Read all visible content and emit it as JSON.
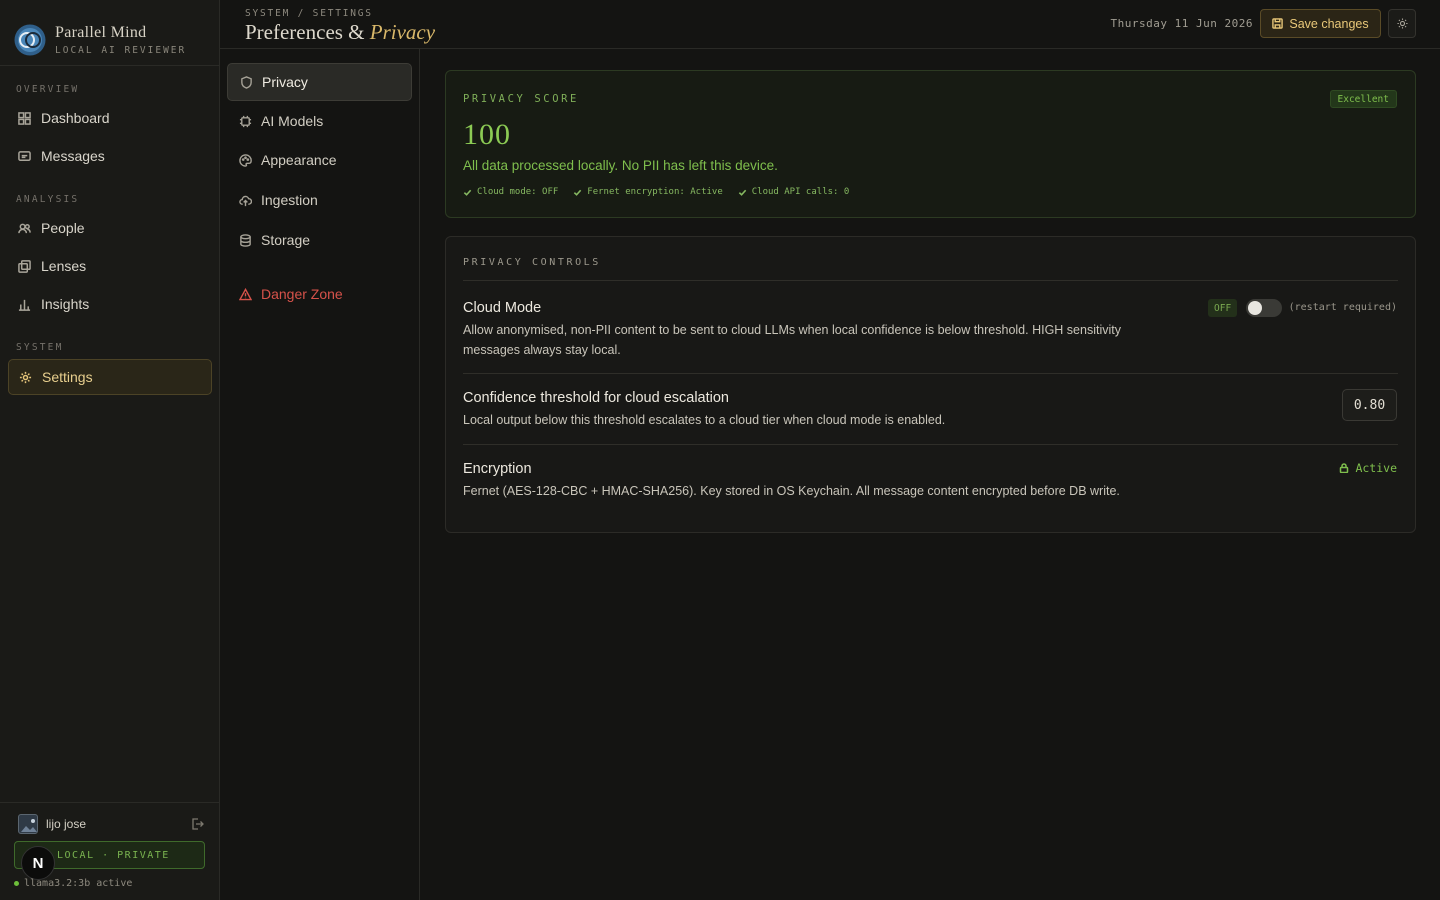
{
  "brand": {
    "name": "Parallel Mind",
    "tagline": "LOCAL AI REVIEWER"
  },
  "sidebar": {
    "sections": [
      {
        "label": "OVERVIEW",
        "items": [
          {
            "label": "Dashboard",
            "icon": "grid-icon"
          },
          {
            "label": "Messages",
            "icon": "message-icon"
          }
        ]
      },
      {
        "label": "ANALYSIS",
        "items": [
          {
            "label": "People",
            "icon": "people-icon"
          },
          {
            "label": "Lenses",
            "icon": "lenses-icon"
          },
          {
            "label": "Insights",
            "icon": "bar-chart-icon"
          }
        ]
      },
      {
        "label": "SYSTEM",
        "items": [
          {
            "label": "Settings",
            "icon": "gear-icon",
            "active": true
          }
        ]
      }
    ],
    "user": {
      "name": "lijo jose"
    },
    "local_badge": "LOCAL · PRIVATE",
    "avatar_initial": "N",
    "model_status": "llama3.2:3b active"
  },
  "header": {
    "breadcrumb": "SYSTEM / SETTINGS",
    "title_main": "Preferences & ",
    "title_accent": "Privacy",
    "date": "Thursday 11 Jun 2026",
    "save_label": "Save changes"
  },
  "subnav": {
    "items": [
      {
        "label": "Privacy",
        "icon": "shield-icon",
        "active": true
      },
      {
        "label": "AI Models",
        "icon": "chip-icon"
      },
      {
        "label": "Appearance",
        "icon": "palette-icon"
      },
      {
        "label": "Ingestion",
        "icon": "cloud-upload-icon"
      },
      {
        "label": "Storage",
        "icon": "database-icon"
      }
    ],
    "danger": {
      "label": "Danger Zone",
      "icon": "warning-icon"
    }
  },
  "privacy_score": {
    "label": "PRIVACY SCORE",
    "badge": "Excellent",
    "value": "100",
    "description": "All data processed locally. No PII has left this device.",
    "checks": [
      "Cloud mode: OFF",
      "Fernet encryption: Active",
      "Cloud API calls: 0"
    ]
  },
  "privacy_controls": {
    "label": "PRIVACY CONTROLS",
    "cloud_mode": {
      "title": "Cloud Mode",
      "description": "Allow anonymised, non-PII content to be sent to cloud LLMs when local confidence is below threshold. HIGH sensitivity messages always stay local.",
      "state_tag": "OFF",
      "enabled": false,
      "note": "(restart required)"
    },
    "confidence": {
      "title": "Confidence threshold for cloud escalation",
      "description": "Local output below this threshold escalates to a cloud tier when cloud mode is enabled.",
      "value": "0.80"
    },
    "encryption": {
      "title": "Encryption",
      "description": "Fernet (AES-128-CBC + HMAC-SHA256). Key stored in OS Keychain. All message content encrypted before DB write.",
      "status": "Active"
    }
  },
  "colors": {
    "accent": "#e4c47a",
    "success": "#7fbf4d",
    "danger": "#d6524a",
    "background": "#141412"
  }
}
